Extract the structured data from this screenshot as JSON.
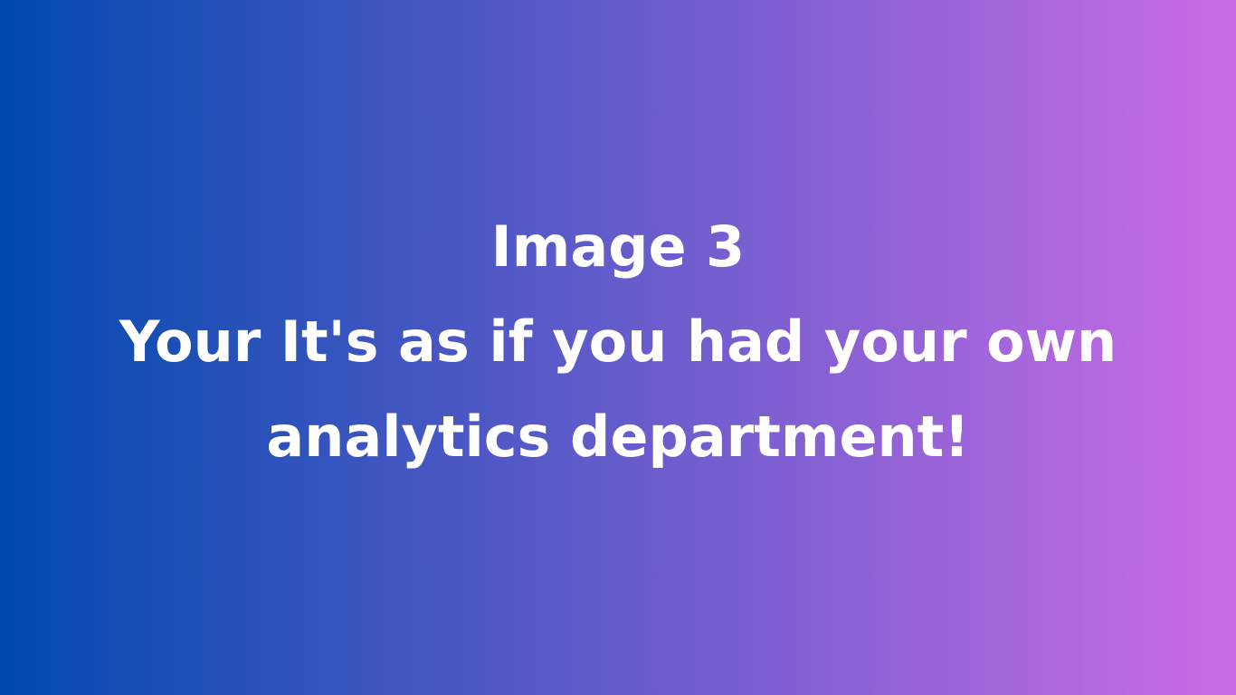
{
  "slide": {
    "background": {
      "start_color": "#004aad",
      "end_color": "#cb6ce6",
      "text_color": "#ffffff"
    },
    "heading": "Image 3",
    "body_line_1": "Your It's as if you had your own",
    "body_line_2": "analytics department!"
  }
}
